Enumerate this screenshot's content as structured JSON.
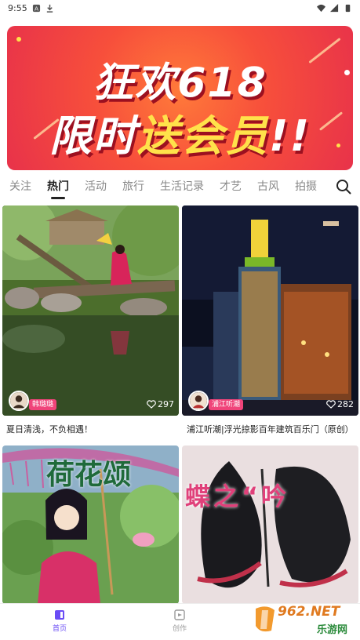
{
  "status_bar": {
    "time": "9:55"
  },
  "banner": {
    "line1": "狂欢618",
    "line2_prefix": "限时",
    "line2_highlight": "送会员",
    "line2_suffix": "!!"
  },
  "tabs": [
    {
      "label": "关注",
      "active": false
    },
    {
      "label": "热门",
      "active": true
    },
    {
      "label": "活动",
      "active": false
    },
    {
      "label": "旅行",
      "active": false
    },
    {
      "label": "生活记录",
      "active": false
    },
    {
      "label": "才艺",
      "active": false
    },
    {
      "label": "古风",
      "active": false
    },
    {
      "label": "拍摄",
      "active": false
    }
  ],
  "posts": [
    {
      "author": "韩璐璐",
      "likes": "297",
      "title": "夏日清浅，不负相遇！"
    },
    {
      "author": "浦江听潮",
      "likes": "282",
      "title": "浦江听潮|浮光掠影百年建筑百乐门（原创）"
    },
    {
      "overlay_text": "荷花颂"
    },
    {
      "overlay_text": "蝶之“吟"
    }
  ],
  "bottom_nav": [
    {
      "label": "首页",
      "active": true
    },
    {
      "label": "创作",
      "active": false
    }
  ],
  "watermark": {
    "brand": "962.NET",
    "sub": "乐游网"
  },
  "colors": {
    "accent": "#6a4cf5",
    "tag": "#f0447a",
    "banner": "#f74f3b"
  }
}
